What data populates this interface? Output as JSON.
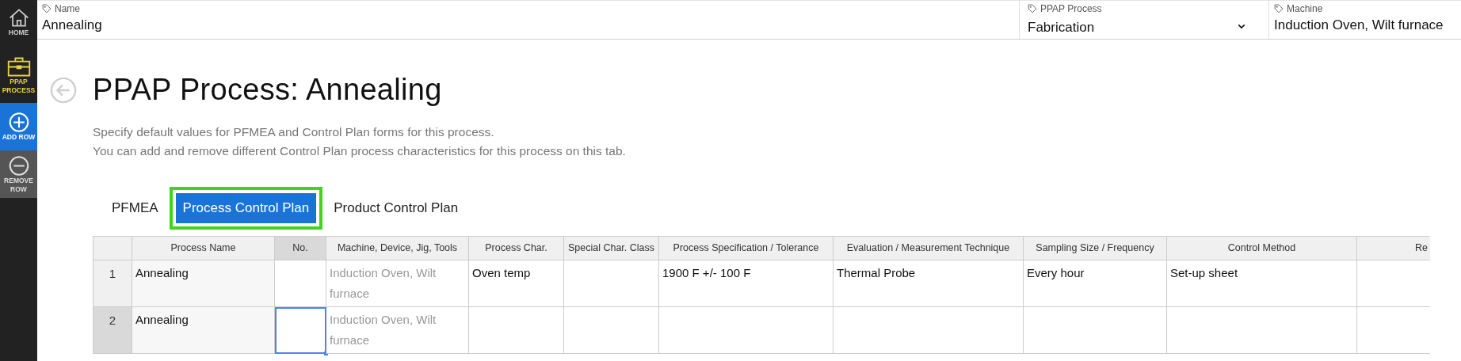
{
  "sidebar": {
    "items": [
      {
        "kind": "home",
        "label": "HOME",
        "selected": false
      },
      {
        "kind": "process",
        "label": "PPAP PROCESS",
        "selected": true
      },
      {
        "kind": "add",
        "label": "ADD ROW",
        "selected": false
      },
      {
        "kind": "remove",
        "label": "REMOVE ROW",
        "selected": false
      }
    ]
  },
  "header_fields": [
    {
      "kind": "text",
      "label": "Name",
      "value": "Annealing"
    },
    {
      "kind": "dropdown",
      "label": "PPAP Process",
      "value": "Fabrication"
    },
    {
      "kind": "text",
      "label": "Machine",
      "value": "Induction Oven, Wilt furnace"
    }
  ],
  "title": "PPAP Process: Annealing",
  "description": [
    "Specify default values for PFMEA and Control Plan forms for this process.",
    "You can add and remove different Control Plan process characteristics for this process on this tab."
  ],
  "tabs": [
    {
      "label": "PFMEA",
      "selected": false,
      "highlighted": false
    },
    {
      "label": "Process Control Plan",
      "selected": true,
      "highlighted": true
    },
    {
      "label": "Product Control Plan",
      "selected": false,
      "highlighted": false
    }
  ],
  "table": {
    "columns": [
      {
        "label": "Process Name",
        "selected": false,
        "muted": false
      },
      {
        "label": "No.",
        "selected": true,
        "muted": false
      },
      {
        "label": "Machine, Device, Jig, Tools",
        "selected": false,
        "muted": true
      },
      {
        "label": "Process Char.",
        "selected": false,
        "muted": false
      },
      {
        "label": "Special Char. Class",
        "selected": false,
        "muted": false
      },
      {
        "label": "Process Specification / Tolerance",
        "selected": false,
        "muted": false
      },
      {
        "label": "Evaluation / Measurement Technique",
        "selected": false,
        "muted": false
      },
      {
        "label": "Sampling Size / Frequency",
        "selected": false,
        "muted": false
      },
      {
        "label": "Control Method",
        "selected": false,
        "muted": false
      },
      {
        "label": "Re",
        "selected": false,
        "muted": false
      }
    ],
    "rows": [
      {
        "number": "1",
        "selected": false,
        "cells": [
          "Annealing",
          null,
          "Induction Oven, Wilt furnace",
          "Oven temp",
          null,
          "1900 F +/- 100 F",
          "Thermal Probe",
          "Every hour",
          "Set-up sheet",
          null
        ]
      },
      {
        "number": "2",
        "selected": true,
        "cells": [
          "Annealing",
          null,
          "Induction Oven, Wilt furnace",
          null,
          null,
          null,
          null,
          null,
          null,
          null
        ]
      }
    ]
  }
}
